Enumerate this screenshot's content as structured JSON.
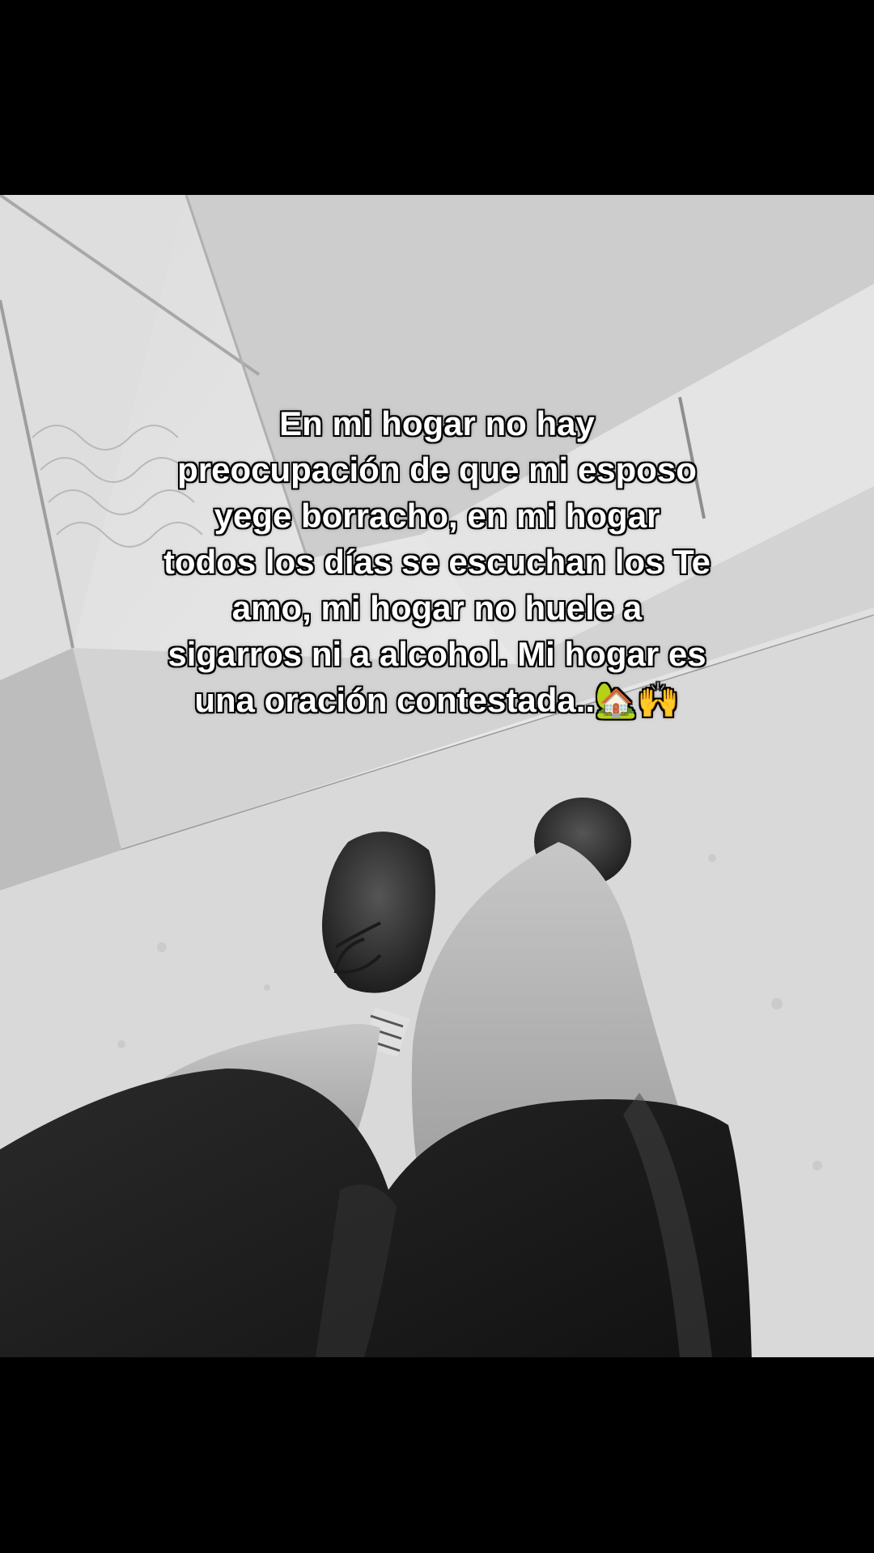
{
  "caption": {
    "lines": [
      "En mi hogar  no hay",
      "preocupación de que  mi esposo",
      "yege borracho, en mi hogar",
      "todos los días se escuchan los Te",
      "amo, mi hogar no huele a",
      "sigarros ni a alcohol. Mi hogar es",
      "una oración contestada.."
    ],
    "emoji_1": "🏡",
    "emoji_2": "🙌"
  },
  "photo": {
    "description_icon": "feet-on-concrete-photo",
    "colors": {
      "floor_light": "#e6e6e6",
      "floor_mid": "#c9c9c9",
      "floor_dark": "#9a9a9a",
      "shoe": "#2b2b2b",
      "skin": "#b8b8b8",
      "shorts": "#1a1a1a"
    }
  }
}
